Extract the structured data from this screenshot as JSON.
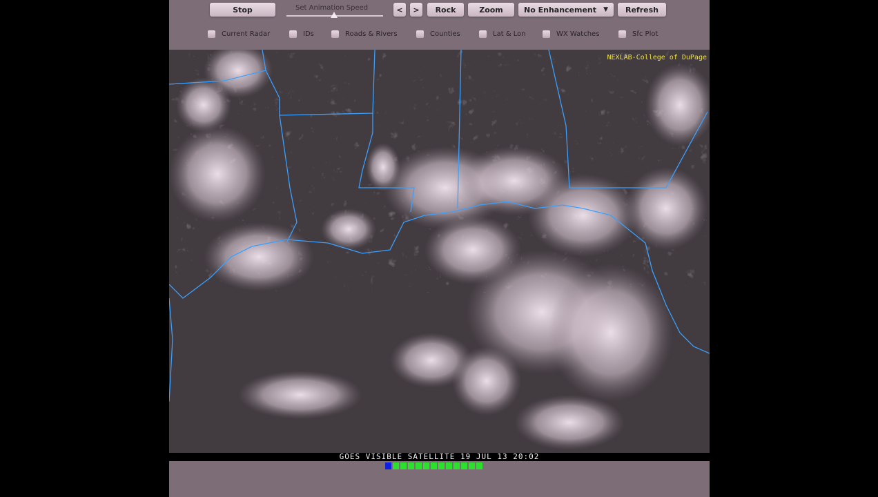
{
  "toolbar": {
    "stop": "Stop",
    "speed_label": "Set Animation Speed",
    "speed_value": 0.5,
    "prev": "<",
    "next": ">",
    "rock": "Rock",
    "zoom": "Zoom",
    "enhancement": "No Enhancement",
    "dropdown_arrow": "▼",
    "refresh": "Refresh"
  },
  "overlays": [
    "Current Radar",
    "IDs",
    "Roads & Rivers",
    "Counties",
    "Lat & Lon",
    "WX Watches",
    "Sfc Plot"
  ],
  "map": {
    "credit": "NEXLAB-College of DuPage",
    "caption": "GOES VISIBLE SATELLITE  19 JUL 13  20:02"
  },
  "frames": {
    "total": 13,
    "current": 1
  },
  "colors": {
    "border": "#3aa0ff",
    "current_frame": "#1020e0",
    "frame": "#2de02d"
  }
}
